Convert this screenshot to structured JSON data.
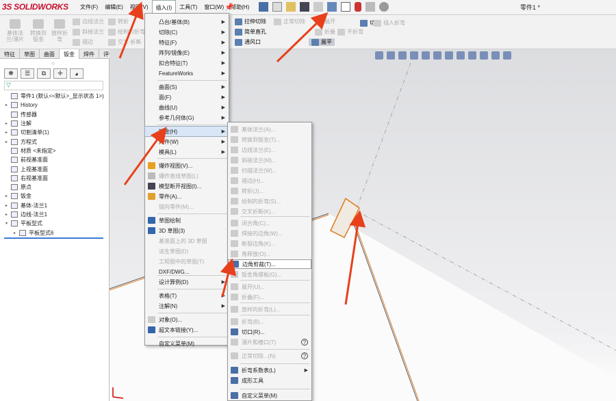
{
  "app": {
    "logo": "SOLIDWORKS",
    "logo_prefix": "3S",
    "doc_title": "零件1 *"
  },
  "menubar": [
    "文件(F)",
    "编辑(E)",
    "视图(V)",
    "插入(I)",
    "工具(T)",
    "窗口(W)",
    "帮助(H)"
  ],
  "ribbon_left": [
    {
      "label": "基体法兰/薄片"
    },
    {
      "label": "转换到钣金"
    },
    {
      "label": "放样折弯"
    }
  ],
  "ribbon_small": [
    "边线法兰",
    "斜接法兰",
    "褶边",
    "转折",
    "绘制的折弯",
    "交叉-折断"
  ],
  "ribbon_right": [
    {
      "label": "拉伸切除",
      "enabled": true
    },
    {
      "label": "简单直孔",
      "enabled": true
    },
    {
      "label": "通风口",
      "enabled": true
    },
    {
      "label": "正常切除",
      "enabled": false
    },
    {
      "label": "展开",
      "enabled": false
    },
    {
      "label": "折叠",
      "enabled": false
    },
    {
      "label": "不折弯",
      "enabled": false
    },
    {
      "label": "切口",
      "enabled": true
    },
    {
      "label": "插入折弯",
      "enabled": false
    },
    {
      "label": "展平",
      "enabled": true
    }
  ],
  "tabs": [
    "特征",
    "草图",
    "曲面",
    "钣金",
    "焊件",
    "评估"
  ],
  "tree": [
    {
      "label": "零件1 (默认<<默认>_显示状态 1>)",
      "arrow": ""
    },
    {
      "label": "History",
      "arrow": "▸"
    },
    {
      "label": "传感器",
      "arrow": ""
    },
    {
      "label": "注解",
      "arrow": "▸"
    },
    {
      "label": "切割清单(1)",
      "arrow": "▸"
    },
    {
      "label": "方程式",
      "arrow": "▸"
    },
    {
      "label": "材质 <未指定>",
      "arrow": ""
    },
    {
      "label": "前视基准面",
      "arrow": ""
    },
    {
      "label": "上视基准面",
      "arrow": ""
    },
    {
      "label": "右视基准面",
      "arrow": ""
    },
    {
      "label": "原点",
      "arrow": ""
    },
    {
      "label": "钣金",
      "arrow": "▸"
    },
    {
      "label": "基体-法兰1",
      "arrow": "▸"
    },
    {
      "label": "边线-法兰1",
      "arrow": "▸"
    },
    {
      "label": "平板型式",
      "arrow": "▾"
    },
    {
      "label": "平板型式6",
      "arrow": "▸"
    }
  ],
  "insert_menu": [
    {
      "label": "凸台/基体(B)",
      "sub": true
    },
    {
      "label": "切除(C)",
      "sub": true
    },
    {
      "label": "特征(F)",
      "sub": true
    },
    {
      "label": "阵列/镜像(E)",
      "sub": true
    },
    {
      "label": "扣合特征(T)",
      "sub": true
    },
    {
      "label": "FeatureWorks",
      "sub": true
    },
    {
      "label": "曲面(S)",
      "sub": true
    },
    {
      "label": "面(F)",
      "sub": true
    },
    {
      "label": "曲线(U)",
      "sub": true
    },
    {
      "label": "参考几何体(G)",
      "sub": true
    },
    {
      "label": "钣金(H)",
      "sub": true
    },
    {
      "label": "焊件(W)",
      "sub": true
    },
    {
      "label": "模具(L)",
      "sub": true
    },
    {
      "label": "爆炸视图(V)...",
      "sub": false
    },
    {
      "label": "爆炸直线草图(L)",
      "sub": false
    },
    {
      "label": "模型断开视图(I)...",
      "sub": false
    },
    {
      "label": "零件(A)...",
      "sub": false
    },
    {
      "label": "镜向零件(M)...",
      "sub": false
    },
    {
      "label": "草图绘制",
      "sub": false
    },
    {
      "label": "3D 草图(3)",
      "sub": false
    },
    {
      "label": "基准面上的 3D 草图",
      "sub": false
    },
    {
      "label": "派生草图(D)",
      "sub": false
    },
    {
      "label": "工程图中的草图(T)",
      "sub": false
    },
    {
      "label": "DXF/DWG...",
      "sub": false
    },
    {
      "label": "设计算例(D)",
      "sub": true
    },
    {
      "label": "表格(T)",
      "sub": true
    },
    {
      "label": "注解(N)",
      "sub": true
    },
    {
      "label": "对象(O)...",
      "sub": false
    },
    {
      "label": "超文本链接(Y)...",
      "sub": false
    },
    {
      "label": "自定义菜单(M)",
      "sub": false
    }
  ],
  "sheetmetal_menu": [
    {
      "label": "基体法兰(A)...",
      "enabled": false
    },
    {
      "label": "转换到钣金(T)...",
      "enabled": false
    },
    {
      "label": "边线法兰(E)...",
      "enabled": false
    },
    {
      "label": "斜接法兰(M)...",
      "enabled": false
    },
    {
      "label": "扫描法兰(W)...",
      "enabled": false
    },
    {
      "label": "褶边(H)...",
      "enabled": false
    },
    {
      "label": "转折(J)...",
      "enabled": false
    },
    {
      "label": "绘制的折弯(S)...",
      "enabled": false
    },
    {
      "label": "交叉折断(K)...",
      "enabled": false
    },
    {
      "label": "闭合角(C)...",
      "enabled": false
    },
    {
      "label": "焊接的边角(W)...",
      "enabled": false
    },
    {
      "label": "断裂边角(K)...",
      "enabled": false
    },
    {
      "label": "角释放(O)...",
      "enabled": false
    },
    {
      "label": "边角剪裁(T)...",
      "enabled": true
    },
    {
      "label": "钣金角撑板(G)...",
      "enabled": false
    },
    {
      "label": "展开(U)...",
      "enabled": false
    },
    {
      "label": "折叠(F)...",
      "enabled": false
    },
    {
      "label": "放样的折弯(L)...",
      "enabled": false
    },
    {
      "label": "折弯(B)...",
      "enabled": false
    },
    {
      "label": "切口(R)...",
      "enabled": true
    },
    {
      "label": "薄片和槽口(T)",
      "enabled": false
    },
    {
      "label": "正常切除...(N)",
      "enabled": false
    },
    {
      "label": "折弯系数表(L)",
      "enabled": true
    },
    {
      "label": "成形工具",
      "enabled": true
    },
    {
      "label": "自定义菜单(M)",
      "enabled": true
    }
  ],
  "colors": {
    "accent": "#e8401c",
    "highlight": "#d8e6f7",
    "logo": "#c8102e"
  }
}
